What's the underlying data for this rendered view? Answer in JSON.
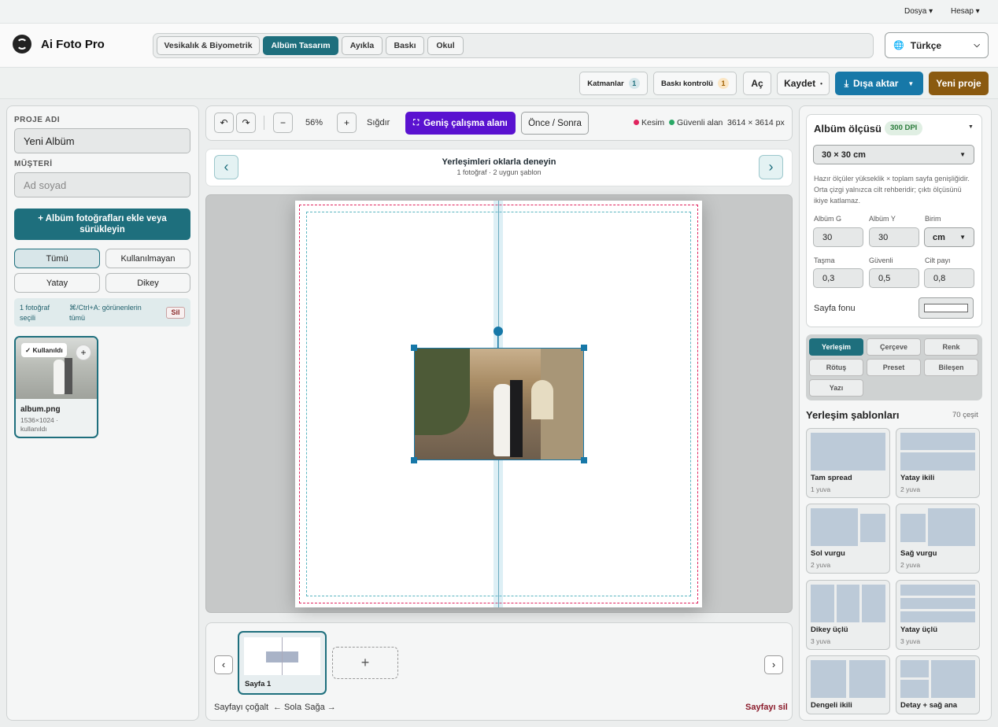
{
  "menu": {
    "file": "Dosya ▾",
    "account": "Hesap ▾"
  },
  "app": {
    "title": "Ai Foto Pro"
  },
  "tabs": [
    "Vesikalık & Biyometrik",
    "Albüm Tasarım",
    "Ayıkla",
    "Baskı",
    "Okul"
  ],
  "language": "Türkçe",
  "actions": {
    "layers": "Katmanlar",
    "layers_count": "1",
    "print_check": "Baskı kontrolü",
    "print_count": "1",
    "open": "Aç",
    "save": "Kaydet",
    "export": "Dışa aktar",
    "new_project": "Yeni proje"
  },
  "left": {
    "project_label": "PROJE ADI",
    "project_value": "Yeni Albüm",
    "client_label": "MÜŞTERİ",
    "client_placeholder": "Ad soyad",
    "add_photos": "+ Albüm fotoğrafları ekle veya sürükleyin",
    "filters": [
      "Tümü",
      "Kullanılmayan",
      "Yatay",
      "Dikey"
    ],
    "selection_count": "1 fotoğraf seçili",
    "selection_hint": "⌘/Ctrl+A: görünenlerin tümü",
    "delete": "Sil",
    "photo": {
      "badge": "✓ Kullanıldı",
      "plus": "+",
      "name": "album.png",
      "meta": "1536×1024 · kullanıldı"
    }
  },
  "canvas_toolbar": {
    "zoom": "56%",
    "minus": "−",
    "plus": "+",
    "fit": "Sığdır",
    "wide": "Geniş çalışma alanı",
    "before_after": "Önce / Sonra",
    "bleed": "Kesim",
    "safe": "Güvenli alan",
    "size": "3614 × 3614 px"
  },
  "layout_nav": {
    "title": "Yerleşimleri oklarla deneyin",
    "subtitle": "1 fotoğraf · 2 uygun şablon"
  },
  "pages": {
    "page1": "Sayfa 1",
    "add": "+",
    "duplicate": "Sayfayı çoğalt",
    "left": "← Sola",
    "right": "Sağa →",
    "delete": "Sayfayı sil"
  },
  "right": {
    "album_size": "Albüm ölçüsü",
    "dpi": "300 DPI",
    "size_select": "30 × 30 cm",
    "hint": "Hazır ölçüler yükseklik × toplam sayfa genişliğidir. Orta çizgi yalnızca cilt rehberidir; çıktı ölçüsünü ikiye katlamaz.",
    "fields": [
      {
        "label": "Albüm G",
        "value": "30"
      },
      {
        "label": "Albüm Y",
        "value": "30"
      },
      {
        "label": "Birim",
        "value": "cm"
      },
      {
        "label": "Taşma",
        "value": "0,3"
      },
      {
        "label": "Güvenli",
        "value": "0,5"
      },
      {
        "label": "Cilt payı",
        "value": "0,8"
      }
    ],
    "background": "Sayfa fonu",
    "tool_tabs": [
      "Yerleşim",
      "Çerçeve",
      "Renk",
      "Rötuş",
      "Preset",
      "Bileşen",
      "Yazı"
    ],
    "templates_title": "Yerleşim şablonları",
    "templates_count": "70 çeşit",
    "templates": [
      {
        "name": "Tam spread",
        "sub": "1 yuva"
      },
      {
        "name": "Yatay ikili",
        "sub": "2 yuva"
      },
      {
        "name": "Sol vurgu",
        "sub": "2 yuva"
      },
      {
        "name": "Sağ vurgu",
        "sub": "2 yuva"
      },
      {
        "name": "Dikey üçlü",
        "sub": "3 yuva"
      },
      {
        "name": "Yatay üçlü",
        "sub": "3 yuva"
      },
      {
        "name": "Dengeli ikili",
        "sub": ""
      },
      {
        "name": "Detay + sağ ana",
        "sub": ""
      }
    ]
  },
  "colors": {
    "accent": "#1e6f7d",
    "export": "#1778a8",
    "new": "#8a5a10",
    "wide": "#5a12d0",
    "bleed": "#e0245e",
    "safe": "#2aa866"
  }
}
